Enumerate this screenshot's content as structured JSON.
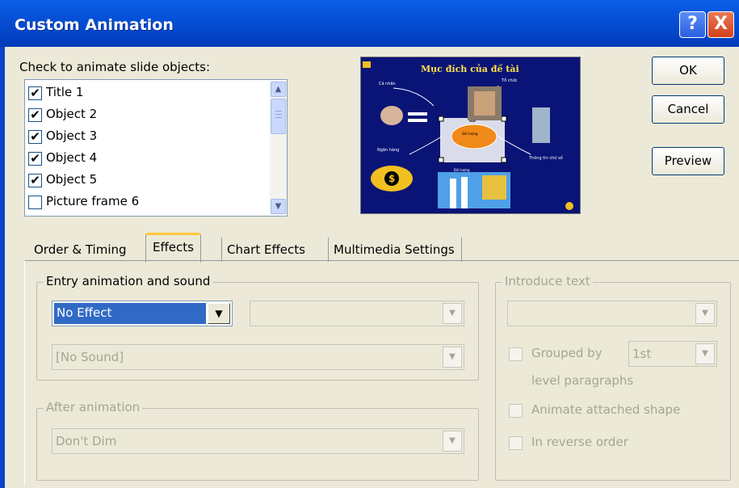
{
  "window": {
    "title": "Custom Animation",
    "help_label": "?",
    "close_label": "X"
  },
  "objects": {
    "label": "Check to animate slide objects:",
    "items": [
      {
        "label": "Title 1",
        "checked": true
      },
      {
        "label": "Object 2",
        "checked": true
      },
      {
        "label": "Object 3",
        "checked": true
      },
      {
        "label": "Object 4",
        "checked": true
      },
      {
        "label": "Object 5",
        "checked": true
      },
      {
        "label": "Picture frame 6",
        "checked": false
      }
    ]
  },
  "buttons": {
    "ok": "OK",
    "cancel": "Cancel",
    "preview": "Preview"
  },
  "tabs": [
    "Order & Timing",
    "Effects",
    "Chart Effects",
    "Multimedia Settings"
  ],
  "active_tab": "Effects",
  "entry": {
    "title": "Entry animation and sound",
    "effect": "No Effect",
    "direction": "",
    "sound": "[No Sound]"
  },
  "after": {
    "title": "After animation",
    "value": "Don't Dim"
  },
  "introduce": {
    "title": "Introduce text",
    "value": "",
    "grouped_label": "Grouped by",
    "grouped_value": "1st",
    "level_label": "level paragraphs",
    "attached_label": "Animate attached shape",
    "reverse_label": "In reverse order"
  },
  "slide_preview": {
    "title": "Mục đích của đề tài",
    "labels": [
      "Cá nhân",
      "Tổ chức",
      "Ngân hàng",
      "Thông tin chữ số",
      "Đối tượng",
      "Đối tượng"
    ]
  },
  "colors": {
    "titlebar": "#0653db",
    "face": "#ece9d8",
    "slide_bg": "#0a1476",
    "slide_title": "#ffe14a"
  }
}
